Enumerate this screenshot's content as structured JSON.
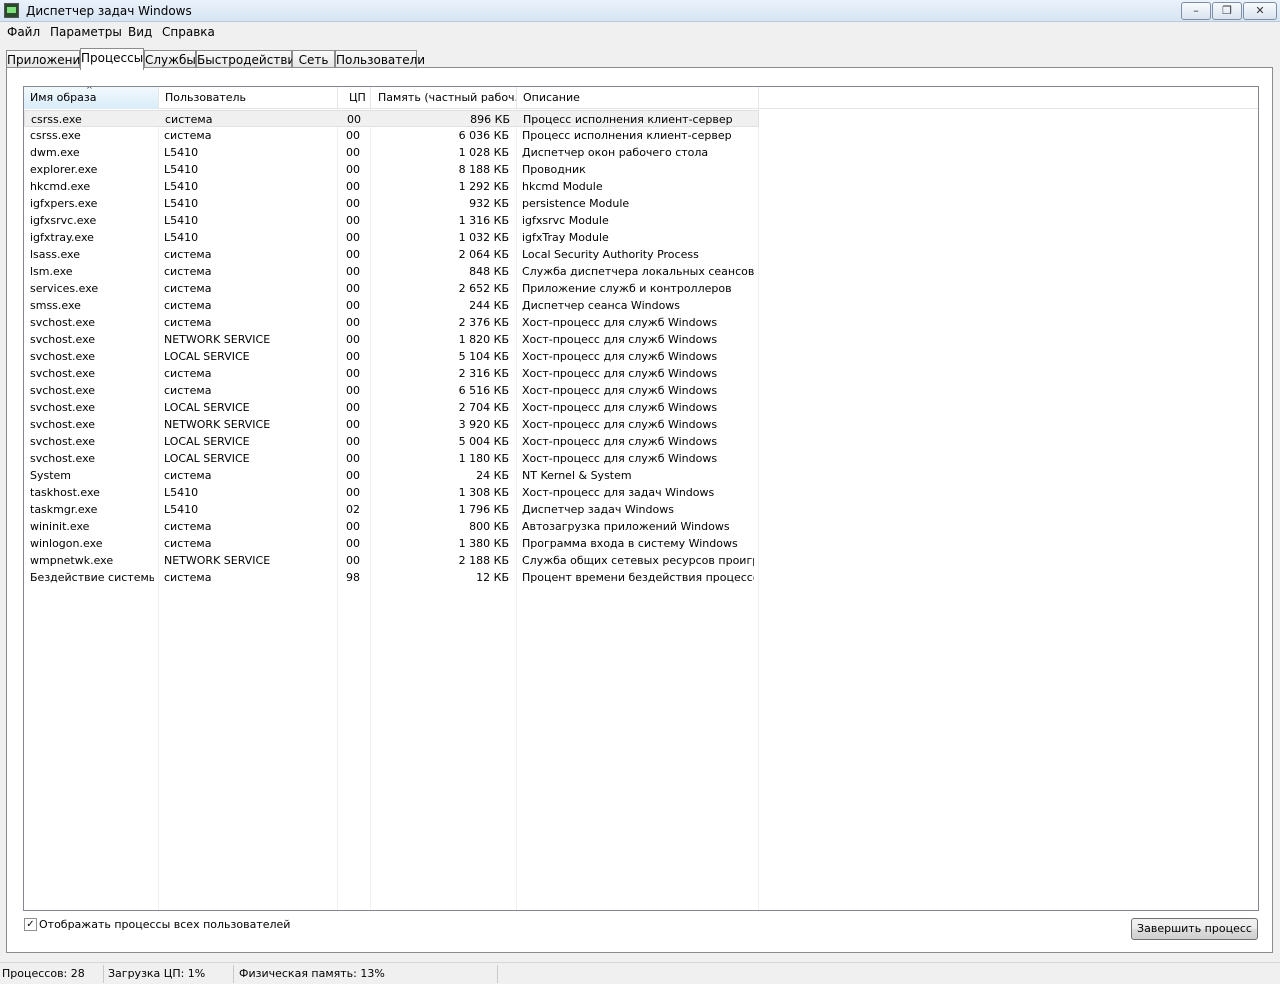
{
  "window": {
    "title": "Диспетчер задач Windows",
    "controls": {
      "minimize": "–",
      "maximize": "❐",
      "close": "✕"
    }
  },
  "menu": [
    "Файл",
    "Параметры",
    "Вид",
    "Справка"
  ],
  "tabs": [
    "Приложения",
    "Процессы",
    "Службы",
    "Быстродействие",
    "Сеть",
    "Пользователи"
  ],
  "active_tab": "Процессы",
  "table": {
    "columns": [
      "Имя образа",
      "Пользователь",
      "ЦП",
      "Память (частный рабоч...",
      "Описание"
    ],
    "sorted_column": "Имя образа",
    "rows": [
      [
        "csrss.exe",
        "система",
        "00",
        "896 КБ",
        "Процесс исполнения клиент-сервер"
      ],
      [
        "csrss.exe",
        "система",
        "00",
        "6 036 КБ",
        "Процесс исполнения клиент-сервер"
      ],
      [
        "dwm.exe",
        "L5410",
        "00",
        "1 028 КБ",
        "Диспетчер окон рабочего стола"
      ],
      [
        "explorer.exe",
        "L5410",
        "00",
        "8 188 КБ",
        "Проводник"
      ],
      [
        "hkcmd.exe",
        "L5410",
        "00",
        "1 292 КБ",
        "hkcmd Module"
      ],
      [
        "igfxpers.exe",
        "L5410",
        "00",
        "932 КБ",
        "persistence Module"
      ],
      [
        "igfxsrvc.exe",
        "L5410",
        "00",
        "1 316 КБ",
        "igfxsrvc Module"
      ],
      [
        "igfxtray.exe",
        "L5410",
        "00",
        "1 032 КБ",
        "igfxTray Module"
      ],
      [
        "lsass.exe",
        "система",
        "00",
        "2 064 КБ",
        "Local Security Authority Process"
      ],
      [
        "lsm.exe",
        "система",
        "00",
        "848 КБ",
        "Служба диспетчера локальных сеансов"
      ],
      [
        "services.exe",
        "система",
        "00",
        "2 652 КБ",
        "Приложение служб и контроллеров"
      ],
      [
        "smss.exe",
        "система",
        "00",
        "244 КБ",
        "Диспетчер сеанса  Windows"
      ],
      [
        "svchost.exe",
        "система",
        "00",
        "2 376 КБ",
        "Хост-процесс для служб Windows"
      ],
      [
        "svchost.exe",
        "NETWORK SERVICE",
        "00",
        "1 820 КБ",
        "Хост-процесс для служб Windows"
      ],
      [
        "svchost.exe",
        "LOCAL SERVICE",
        "00",
        "5 104 КБ",
        "Хост-процесс для служб Windows"
      ],
      [
        "svchost.exe",
        "система",
        "00",
        "2 316 КБ",
        "Хост-процесс для служб Windows"
      ],
      [
        "svchost.exe",
        "система",
        "00",
        "6 516 КБ",
        "Хост-процесс для служб Windows"
      ],
      [
        "svchost.exe",
        "LOCAL SERVICE",
        "00",
        "2 704 КБ",
        "Хост-процесс для служб Windows"
      ],
      [
        "svchost.exe",
        "NETWORK SERVICE",
        "00",
        "3 920 КБ",
        "Хост-процесс для служб Windows"
      ],
      [
        "svchost.exe",
        "LOCAL SERVICE",
        "00",
        "5 004 КБ",
        "Хост-процесс для служб Windows"
      ],
      [
        "svchost.exe",
        "LOCAL SERVICE",
        "00",
        "1 180 КБ",
        "Хост-процесс для служб Windows"
      ],
      [
        "System",
        "система",
        "00",
        "24 КБ",
        "NT Kernel & System"
      ],
      [
        "taskhost.exe",
        "L5410",
        "00",
        "1 308 КБ",
        "Хост-процесс для задач Windows"
      ],
      [
        "taskmgr.exe",
        "L5410",
        "02",
        "1 796 КБ",
        "Диспетчер задач Windows"
      ],
      [
        "wininit.exe",
        "система",
        "00",
        "800 КБ",
        "Автозагрузка приложений Windows"
      ],
      [
        "winlogon.exe",
        "система",
        "00",
        "1 380 КБ",
        "Программа входа в систему Windows"
      ],
      [
        "wmpnetwk.exe",
        "NETWORK SERVICE",
        "00",
        "2 188 КБ",
        "Служба общих сетевых ресурсов проигры…"
      ],
      [
        "Бездействие системы",
        "система",
        "98",
        "12 КБ",
        "Процент времени бездействия процессора"
      ]
    ],
    "selected_row": 0
  },
  "show_all_users": {
    "label": "Отображать процессы всех пользователей",
    "checked": true,
    "mark": "✓"
  },
  "end_process_button": "Завершить процесс",
  "status": {
    "processes": "Процессов: 28",
    "cpu": "Загрузка ЦП: 1%",
    "memory": "Физическая память: 13%"
  }
}
